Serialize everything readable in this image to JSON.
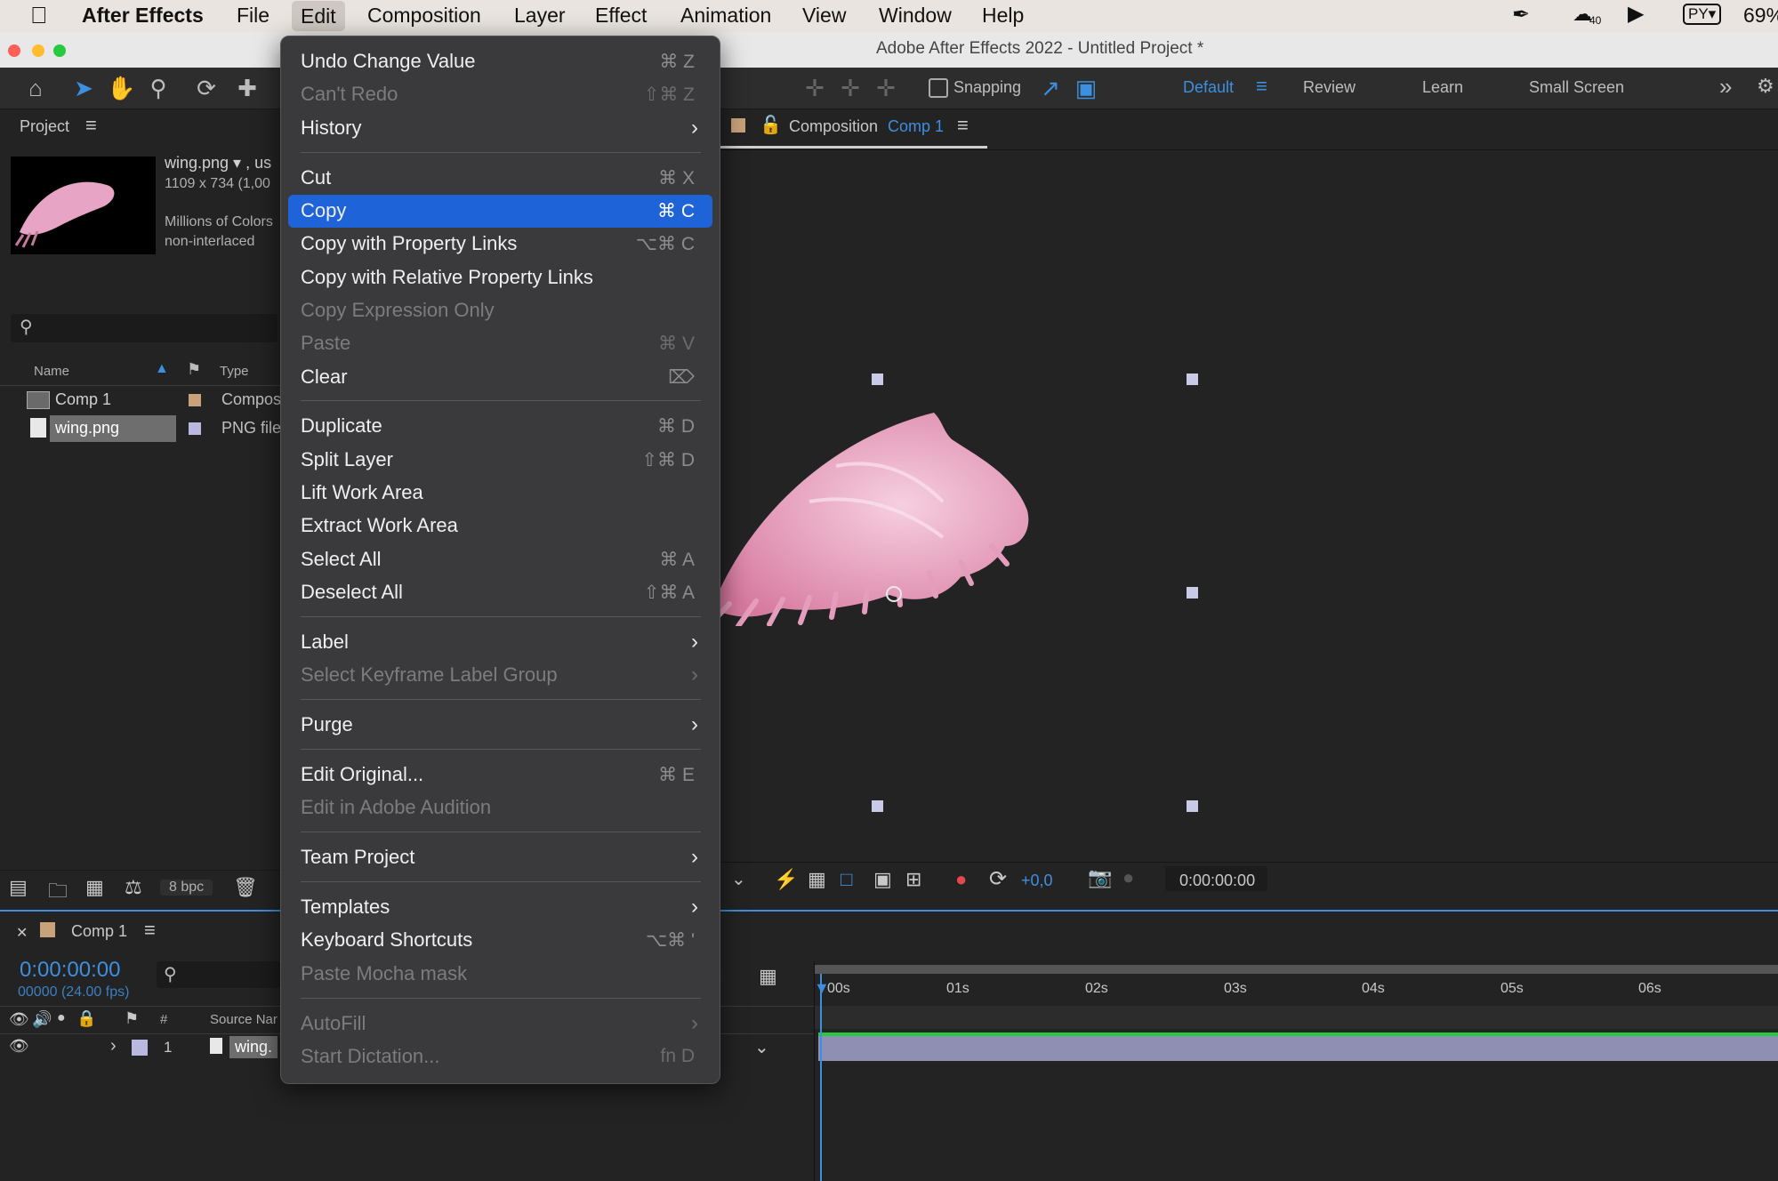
{
  "menubar": {
    "app": "After Effects",
    "items": [
      "File",
      "Edit",
      "Composition",
      "Layer",
      "Effect",
      "Animation",
      "View",
      "Window",
      "Help"
    ],
    "badge": "40",
    "lang": "PY▾",
    "battery": "69%"
  },
  "window": {
    "title": "Adobe After Effects 2022 - Untitled Project *"
  },
  "toolbar": {
    "snapping": "Snapping",
    "workspaces": [
      "Default",
      "Review",
      "Learn",
      "Small Screen"
    ]
  },
  "project": {
    "title": "Project",
    "file_name": "wing.png ▾ , us",
    "dims": "1109 x 734 (1,00",
    "colors": "Millions of Colors",
    "interlace": "non-interlaced",
    "columns": {
      "name": "Name",
      "type": "Type"
    },
    "rows": [
      {
        "name": "Comp 1",
        "type": "Compos"
      },
      {
        "name": "wing.png",
        "type": "PNG file"
      }
    ],
    "bpc": "8 bpc"
  },
  "composition": {
    "tab_prefix": "Composition",
    "tab_name": "Comp 1",
    "exposure": "+0,0",
    "timecode": "0:00:00:00"
  },
  "timeline": {
    "tab": "Comp 1",
    "timecode": "0:00:00:00",
    "frames": "00000 (24.00 fps)",
    "col_num": "#",
    "col_source": "Source Nar",
    "layer_num": "1",
    "layer_name": "wing.",
    "ticks": [
      "00s",
      "01s",
      "02s",
      "03s",
      "04s",
      "05s",
      "06s"
    ]
  },
  "edit_menu": {
    "items": [
      {
        "label": "Undo Change Value",
        "shortcut": "⌘ Z",
        "disabled": false
      },
      {
        "label": "Can't Redo",
        "shortcut": "⇧⌘ Z",
        "disabled": true
      },
      {
        "label": "History",
        "shortcut": "",
        "disabled": false,
        "submenu": true
      },
      {
        "label": "Cut",
        "shortcut": "⌘ X",
        "disabled": false
      },
      {
        "label": "Copy",
        "shortcut": "⌘ C",
        "disabled": false,
        "selected": true
      },
      {
        "label": "Copy with Property Links",
        "shortcut": "⌥⌘ C",
        "disabled": false
      },
      {
        "label": "Copy with Relative Property Links",
        "shortcut": "",
        "disabled": false
      },
      {
        "label": "Copy Expression Only",
        "shortcut": "",
        "disabled": true
      },
      {
        "label": "Paste",
        "shortcut": "⌘ V",
        "disabled": true
      },
      {
        "label": "Clear",
        "shortcut": "⌦",
        "disabled": false
      },
      {
        "label": "Duplicate",
        "shortcut": "⌘ D",
        "disabled": false
      },
      {
        "label": "Split Layer",
        "shortcut": "⇧⌘ D",
        "disabled": false
      },
      {
        "label": "Lift Work Area",
        "shortcut": "",
        "disabled": false
      },
      {
        "label": "Extract Work Area",
        "shortcut": "",
        "disabled": false
      },
      {
        "label": "Select All",
        "shortcut": "⌘ A",
        "disabled": false
      },
      {
        "label": "Deselect All",
        "shortcut": "⇧⌘ A",
        "disabled": false
      },
      {
        "label": "Label",
        "shortcut": "",
        "disabled": false,
        "submenu": true
      },
      {
        "label": "Select Keyframe Label Group",
        "shortcut": "",
        "disabled": true,
        "submenu": true
      },
      {
        "label": "Purge",
        "shortcut": "",
        "disabled": false,
        "submenu": true
      },
      {
        "label": "Edit Original...",
        "shortcut": "⌘ E",
        "disabled": false
      },
      {
        "label": "Edit in Adobe Audition",
        "shortcut": "",
        "disabled": true
      },
      {
        "label": "Team Project",
        "shortcut": "",
        "disabled": false,
        "submenu": true
      },
      {
        "label": "Templates",
        "shortcut": "",
        "disabled": false,
        "submenu": true
      },
      {
        "label": "Keyboard Shortcuts",
        "shortcut": "⌥⌘ '",
        "disabled": false
      },
      {
        "label": "Paste Mocha mask",
        "shortcut": "",
        "disabled": true
      },
      {
        "label": "AutoFill",
        "shortcut": "",
        "disabled": true,
        "submenu": true
      },
      {
        "label": "Start Dictation...",
        "shortcut": "fn D",
        "disabled": true
      }
    ]
  },
  "colors": {
    "accent": "#1f63d9",
    "timecode": "#3d8fe0",
    "green": "#27c93f",
    "red": "#ff5f57",
    "yellow": "#ffbd2e"
  }
}
